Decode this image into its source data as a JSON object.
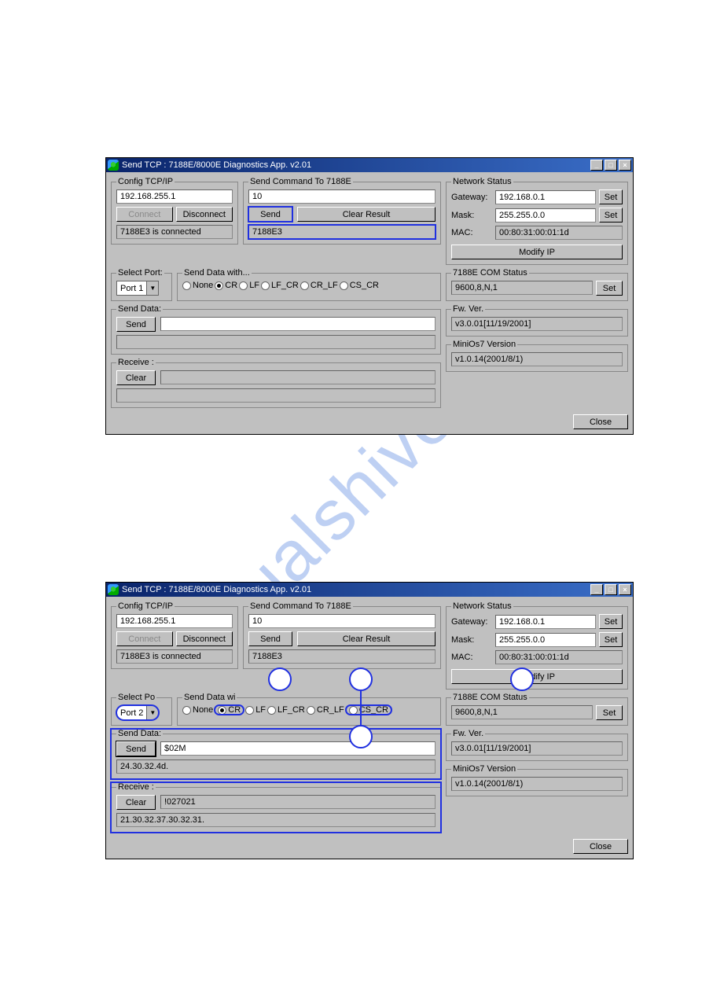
{
  "win1": {
    "title": "Send TCP : 7188E/8000E Diagnostics App. v2.01",
    "sysbtns": {
      "min": "_",
      "max": "□",
      "close": "×"
    },
    "config": {
      "legend": "Config TCP/IP",
      "ip": "192.168.255.1",
      "connect": "Connect",
      "disconnect": "Disconnect",
      "status": "7188E3 is connected"
    },
    "selectport": {
      "legend": "Select Port:",
      "value": "Port 1"
    },
    "senddatawith": {
      "legend": "Send Data with...",
      "opts": [
        "None",
        "CR",
        "LF",
        "LF_CR",
        "CR_LF",
        "CS_CR"
      ],
      "selected": "CR"
    },
    "sendcmd": {
      "legend": "Send Command To 7188E",
      "val": "10",
      "send": "Send",
      "clear": "Clear Result",
      "resp": "7188E3"
    },
    "senddata": {
      "legend": "Send Data:",
      "send": "Send",
      "val": "",
      "hex": ""
    },
    "receive": {
      "legend": "Receive :",
      "clear": "Clear",
      "val": "",
      "hex": ""
    },
    "net": {
      "legend": "Network Status",
      "gwlabel": "Gateway:",
      "gw": "192.168.0.1",
      "masklabel": "Mask:",
      "mask": "255.255.0.0",
      "maclabel": "MAC:",
      "mac": "00:80:31:00:01:1d",
      "set": "Set",
      "modify": "Modify IP"
    },
    "com": {
      "legend": "7188E COM Status",
      "val": "9600,8,N,1",
      "set": "Set"
    },
    "fw": {
      "legend": "Fw. Ver.",
      "val": "v3.0.01[11/19/2001]"
    },
    "mos": {
      "legend": "MiniOs7 Version",
      "val": "v1.0.14(2001/8/1)"
    },
    "close": "Close"
  },
  "win2": {
    "title": "Send TCP : 7188E/8000E Diagnostics App. v2.01",
    "sysbtns": {
      "min": "_",
      "max": "□",
      "close": "×"
    },
    "config": {
      "legend": "Config TCP/IP",
      "ip": "192.168.255.1",
      "connect": "Connect",
      "disconnect": "Disconnect",
      "status": "7188E3 is connected"
    },
    "selectport": {
      "legend": "Select Po",
      "value": "Port 2"
    },
    "senddatawith": {
      "legend": "Send Data wi",
      "opts": [
        "None",
        "CR",
        "LF",
        "LF_CR",
        "CR_LF",
        "CS_CR"
      ],
      "selected": "CR"
    },
    "sendcmd": {
      "legend": "Send Command To 7188E",
      "val": "10",
      "send": "Send",
      "clear": "Clear Result",
      "resp": "7188E3"
    },
    "senddata": {
      "legend": "Send Data:",
      "send": "Send",
      "val": "$02M",
      "hex": "24.30.32.4d."
    },
    "receive": {
      "legend": "Receive :",
      "clear": "Clear",
      "val": "!027021",
      "hex": "21.30.32.37.30.32.31."
    },
    "net": {
      "legend": "Network Status",
      "gwlabel": "Gateway:",
      "gw": "192.168.0.1",
      "masklabel": "Mask:",
      "mask": "255.255.0.0",
      "maclabel": "MAC:",
      "mac": "00:80:31:00:01:1d",
      "set": "Set",
      "modify": "Modify IP"
    },
    "com": {
      "legend": "7188E COM Status",
      "val": "9600,8,N,1",
      "set": "Set"
    },
    "fw": {
      "legend": "Fw. Ver.",
      "val": "v3.0.01[11/19/2001]"
    },
    "mos": {
      "legend": "MiniOs7 Version",
      "val": "v1.0.14(2001/8/1)"
    },
    "close": "Close"
  }
}
